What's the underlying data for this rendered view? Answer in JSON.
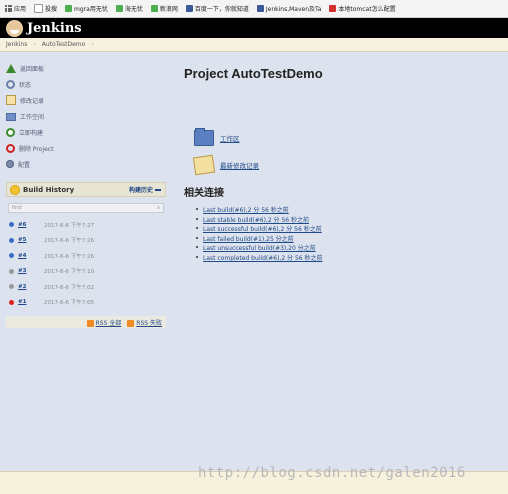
{
  "bookmarks": [
    {
      "label": "应用",
      "color": "#666666"
    },
    {
      "label": "投搜",
      "color": "#999999"
    },
    {
      "label": "mgra用无忧",
      "color": "#4caf50"
    },
    {
      "label": "海无忧",
      "color": "#4caf50"
    },
    {
      "label": "新浪网",
      "color": "#4caf50"
    },
    {
      "label": "百度一下，你就知道",
      "color": "#3b5998"
    },
    {
      "label": "Jenkins,Maven及Ta",
      "color": "#3b5998"
    },
    {
      "label": "本地tomcat怎么配置",
      "color": "#d32f2f"
    }
  ],
  "header": {
    "title": "Jenkins"
  },
  "breadcrumb": [
    "Jenkins",
    "AutoTestDemo"
  ],
  "tasks": [
    {
      "label": "返回面板",
      "icon": "up-arrow-icon"
    },
    {
      "label": "状态",
      "icon": "search-icon"
    },
    {
      "label": "修改记录",
      "icon": "notepad-icon"
    },
    {
      "label": "工作空间",
      "icon": "folder-icon"
    },
    {
      "label": "立即构建",
      "icon": "clock-icon"
    },
    {
      "label": "删除 Project",
      "icon": "no-entry-icon"
    },
    {
      "label": "配置",
      "icon": "gear-icon"
    }
  ],
  "build_history": {
    "title": "Build History",
    "trend_label": "构建历史",
    "filter_placeholder": "find",
    "filter_clear": "x",
    "builds": [
      {
        "number": "#6",
        "date": "2017-6-6 下午7:27",
        "status": "blue"
      },
      {
        "number": "#5",
        "date": "2017-6-6 下午7:26",
        "status": "blue"
      },
      {
        "number": "#4",
        "date": "2017-6-6 下午7:26",
        "status": "blue"
      },
      {
        "number": "#3",
        "date": "2017-6-6 下午7:10",
        "status": "grey"
      },
      {
        "number": "#2",
        "date": "2017-6-6 下午7:02",
        "status": "grey"
      },
      {
        "number": "#1",
        "date": "2017-6-6 下午7:05",
        "status": "red"
      }
    ],
    "rss_all": "RSS 全部",
    "rss_failed": "RSS 失败"
  },
  "main": {
    "title": "Project AutoTestDemo",
    "workspace_label": "工作区",
    "changes_label": "最新修改记录",
    "section_title": "相关连接",
    "permalinks": [
      "Last build(#6),2 分 56 秒之前",
      "Last stable build(#6),2 分 56 秒之前",
      "Last successful build(#6),2 分 56 秒之前",
      "Last failed build(#1),25 分之前",
      "Last unsuccessful build(#3),20 分之前",
      "Last completed build(#6),2 分 56 秒之前"
    ]
  },
  "watermark": "http://blog.csdn.net/galen2016",
  "colors": {
    "link": "#204a87",
    "header_bg": "#000000",
    "page_bg": "#dde3ee"
  }
}
